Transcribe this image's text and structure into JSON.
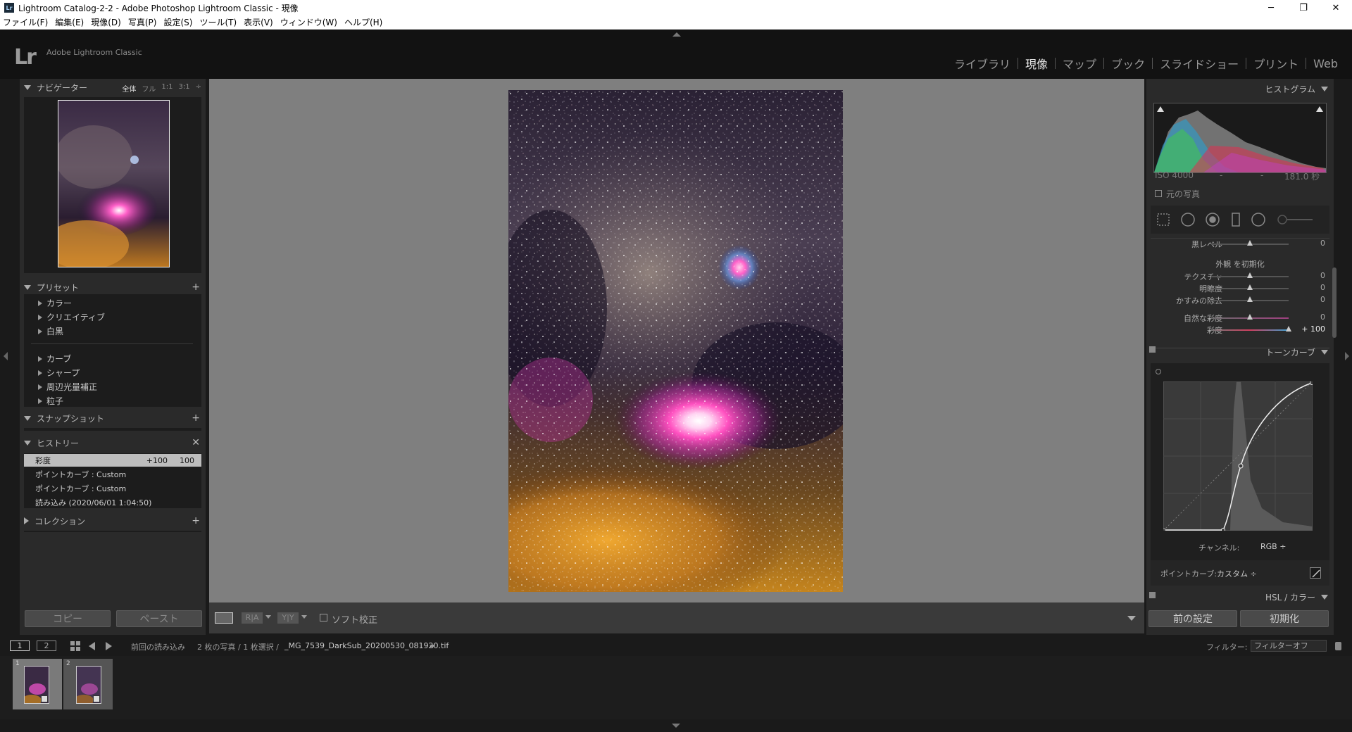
{
  "window": {
    "title": "Lightroom Catalog-2-2 - Adobe Photoshop Lightroom Classic - 現像",
    "app_icon": "Lr",
    "minimize": "─",
    "maximize": "❐",
    "close": "✕"
  },
  "menu": [
    "ファイル(F)",
    "編集(E)",
    "現像(D)",
    "写真(P)",
    "設定(S)",
    "ツール(T)",
    "表示(V)",
    "ウィンドウ(W)",
    "ヘルプ(H)"
  ],
  "brand": {
    "logo": "Lr",
    "name": "Adobe Lightroom Classic"
  },
  "modules": {
    "library": "ライブラリ",
    "develop": "現像",
    "map": "マップ",
    "book": "ブック",
    "slideshow": "スライドショー",
    "print": "プリント",
    "web": "Web"
  },
  "left": {
    "navigator": {
      "title": "ナビゲーター",
      "opt_fit": "全体",
      "opt_fill": "フル",
      "opt_1": "1:1",
      "opt_3": "3:1"
    },
    "presets": {
      "title": "プリセット",
      "plus": "+",
      "items": [
        "カラー",
        "クリエイティブ",
        "白黒",
        "カーブ",
        "シャープ",
        "周辺光量補正",
        "粒子"
      ]
    },
    "snapshots": {
      "title": "スナップショット",
      "plus": "+"
    },
    "history": {
      "title": "ヒストリー",
      "close": "✕",
      "rows": [
        {
          "label": "彩度",
          "v1": "+100",
          "v2": "100"
        },
        {
          "label": "ポイントカーブ : Custom",
          "v1": "",
          "v2": ""
        },
        {
          "label": "ポイントカーブ : Custom",
          "v1": "",
          "v2": ""
        },
        {
          "label": "読み込み (2020/06/01 1:04:50)",
          "v1": "",
          "v2": ""
        }
      ]
    },
    "collections": {
      "title": "コレクション",
      "plus": "+"
    },
    "copy_button": "コピー",
    "paste_button": "ペースト"
  },
  "toolbar": {
    "soft_proof": "ソフト校正",
    "ra": "R|A",
    "yy": "Y|Y"
  },
  "right": {
    "histogram": {
      "title": "ヒストグラム",
      "iso": "ISO 4000",
      "dash1": "-",
      "dash2": "-",
      "shutter": "181.0 秒",
      "original": "元の写真"
    },
    "basic": {
      "black_label": "黒レベル",
      "black_value": "0",
      "presence": "外観 を初期化",
      "sliders": [
        {
          "label": "テクスチャ",
          "value": "0",
          "pos": 0.5
        },
        {
          "label": "明瞭度",
          "value": "0",
          "pos": 0.5
        },
        {
          "label": "かすみの除去",
          "value": "0",
          "pos": 0.5
        },
        {
          "label": "自然な彩度",
          "value": "0",
          "pos": 0.5
        },
        {
          "label": "彩度",
          "value": "+ 100",
          "pos": 1.0
        }
      ]
    },
    "tonecurve": {
      "title": "トーンカーブ",
      "channel_label": "チャンネル:",
      "channel_value": "RGB ÷",
      "pointcurve_label": "ポイントカーブ:",
      "pointcurve_value": "カスタム ÷"
    },
    "hsl": {
      "title": "HSL / カラー"
    },
    "prev_button": "前の設定",
    "reset_button": "初期化"
  },
  "filmbar": {
    "view1": "1",
    "view2": "2",
    "source": "前回の読み込み",
    "info": "2 枚の写真 / 1 枚選択 /",
    "filename": "_MG_7539_DarkSub_20200530_081920.tif",
    "filter_label": "フィルター:",
    "filter_value": "フィルターオフ"
  },
  "filmstrip": {
    "cell1_num": "1",
    "cell2_num": "2"
  },
  "colors": {
    "accent_white": "#e8e8e8",
    "panel": "#2a2a2a",
    "canvas": "#7f7f7f"
  }
}
